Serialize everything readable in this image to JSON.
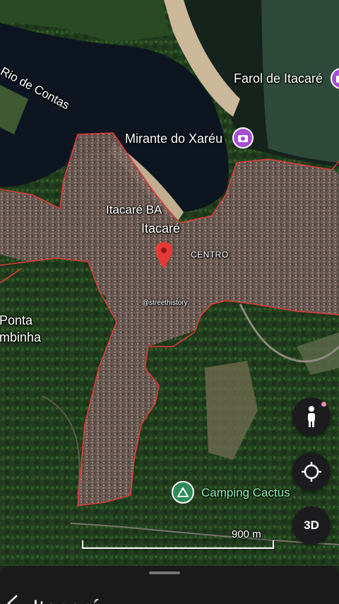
{
  "map": {
    "labels": {
      "rio_de_contas": "Rio de Contas",
      "farol": "Farol de Itacaré",
      "mirante": "Mirante do Xaréu",
      "itacare_ba": "Itacaré BA",
      "itacare": "Itacaré",
      "centro": "CENTRO",
      "watermark": "@streethistory",
      "ponta": "Ponta",
      "pontinha": "mbinha",
      "camping": "Camping Cactus"
    },
    "scale": {
      "label": "900 m"
    },
    "colors": {
      "boundary": "#e03a3a",
      "pin": "#e53935",
      "poi_purple": "#a64ed6",
      "poi_green": "#2e8b57",
      "water": "#0d1620",
      "forest": "#1f3a1c"
    }
  },
  "controls": {
    "pegman_icon": "person-icon",
    "location_icon": "my-location-icon",
    "three_d_label": "3D"
  },
  "sheet": {
    "back_icon": "chevron-left-icon",
    "title": "Itacaré"
  }
}
